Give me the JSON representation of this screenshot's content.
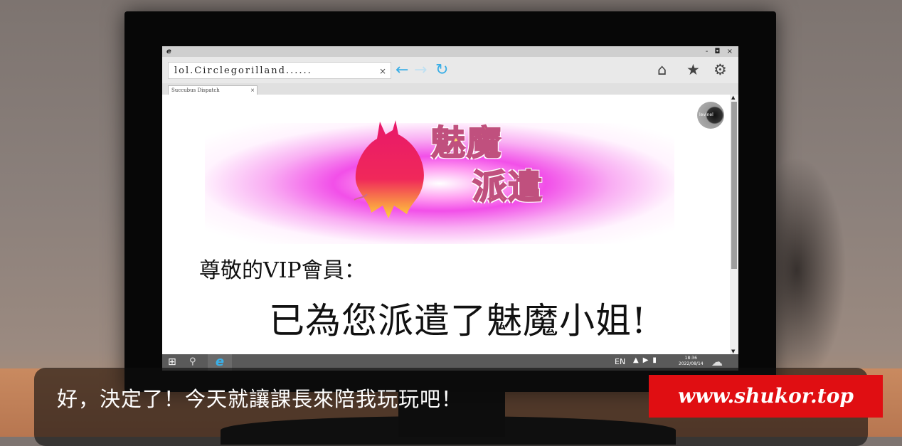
{
  "window": {
    "app_letter": "e",
    "controls": "- ◘ ×"
  },
  "browser": {
    "address": "lol.Circlegorilland......",
    "address_clear": "×",
    "tab_label": "Succubus Dispatch",
    "tab_close": "×"
  },
  "page": {
    "logo_line1": "魅魔",
    "logo_line2": "派遣",
    "avatar_text": "levinel",
    "greeting": "尊敬的VIP會員：",
    "headline": "已為您派遣了魅魔小姐!"
  },
  "taskbar": {
    "language": "EN",
    "time": "18:36",
    "date": "2022/08/14"
  },
  "dialogue": {
    "text": "好，決定了！今天就讓課長來陪我玩玩吧！"
  },
  "watermark": "www.shukor.top",
  "colors": {
    "accent_blue": "#3aaee6",
    "watermark_red": "#e00e12",
    "logo_yellow": "#ffd86e",
    "logo_magenta": "#f03ce6"
  }
}
